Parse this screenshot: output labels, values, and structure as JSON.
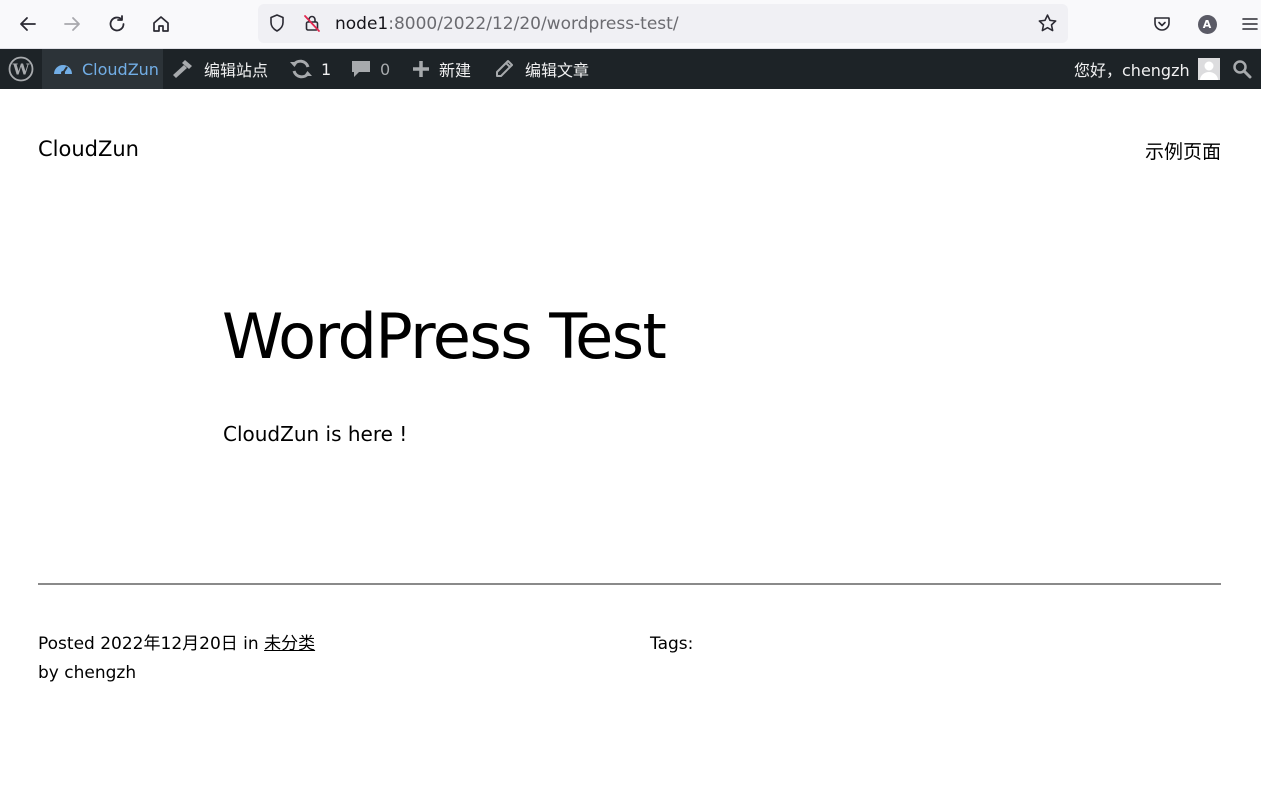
{
  "browser": {
    "url_host": "node1",
    "url_path": ":8000/2022/12/20/wordpress-test/",
    "account_initial": "A"
  },
  "admin_bar": {
    "site_name": "CloudZun",
    "customize_label": "编辑站点",
    "updates_count": "1",
    "comments_count": "0",
    "new_label": "新建",
    "edit_post_label": "编辑文章",
    "greeting": "您好，chengzh",
    "colors": {
      "background": "#1d2327",
      "active_site": "#72aee6"
    }
  },
  "site": {
    "title": "CloudZun",
    "nav": [
      "示例页面"
    ]
  },
  "post": {
    "title": "WordPress Test",
    "content": "CloudZun is here !",
    "posted_label": "Posted",
    "date": "2022年12月20日",
    "in_label": "in",
    "category": "未分类",
    "by_label": "by",
    "author": "chengzh",
    "tags_label": "Tags:"
  }
}
